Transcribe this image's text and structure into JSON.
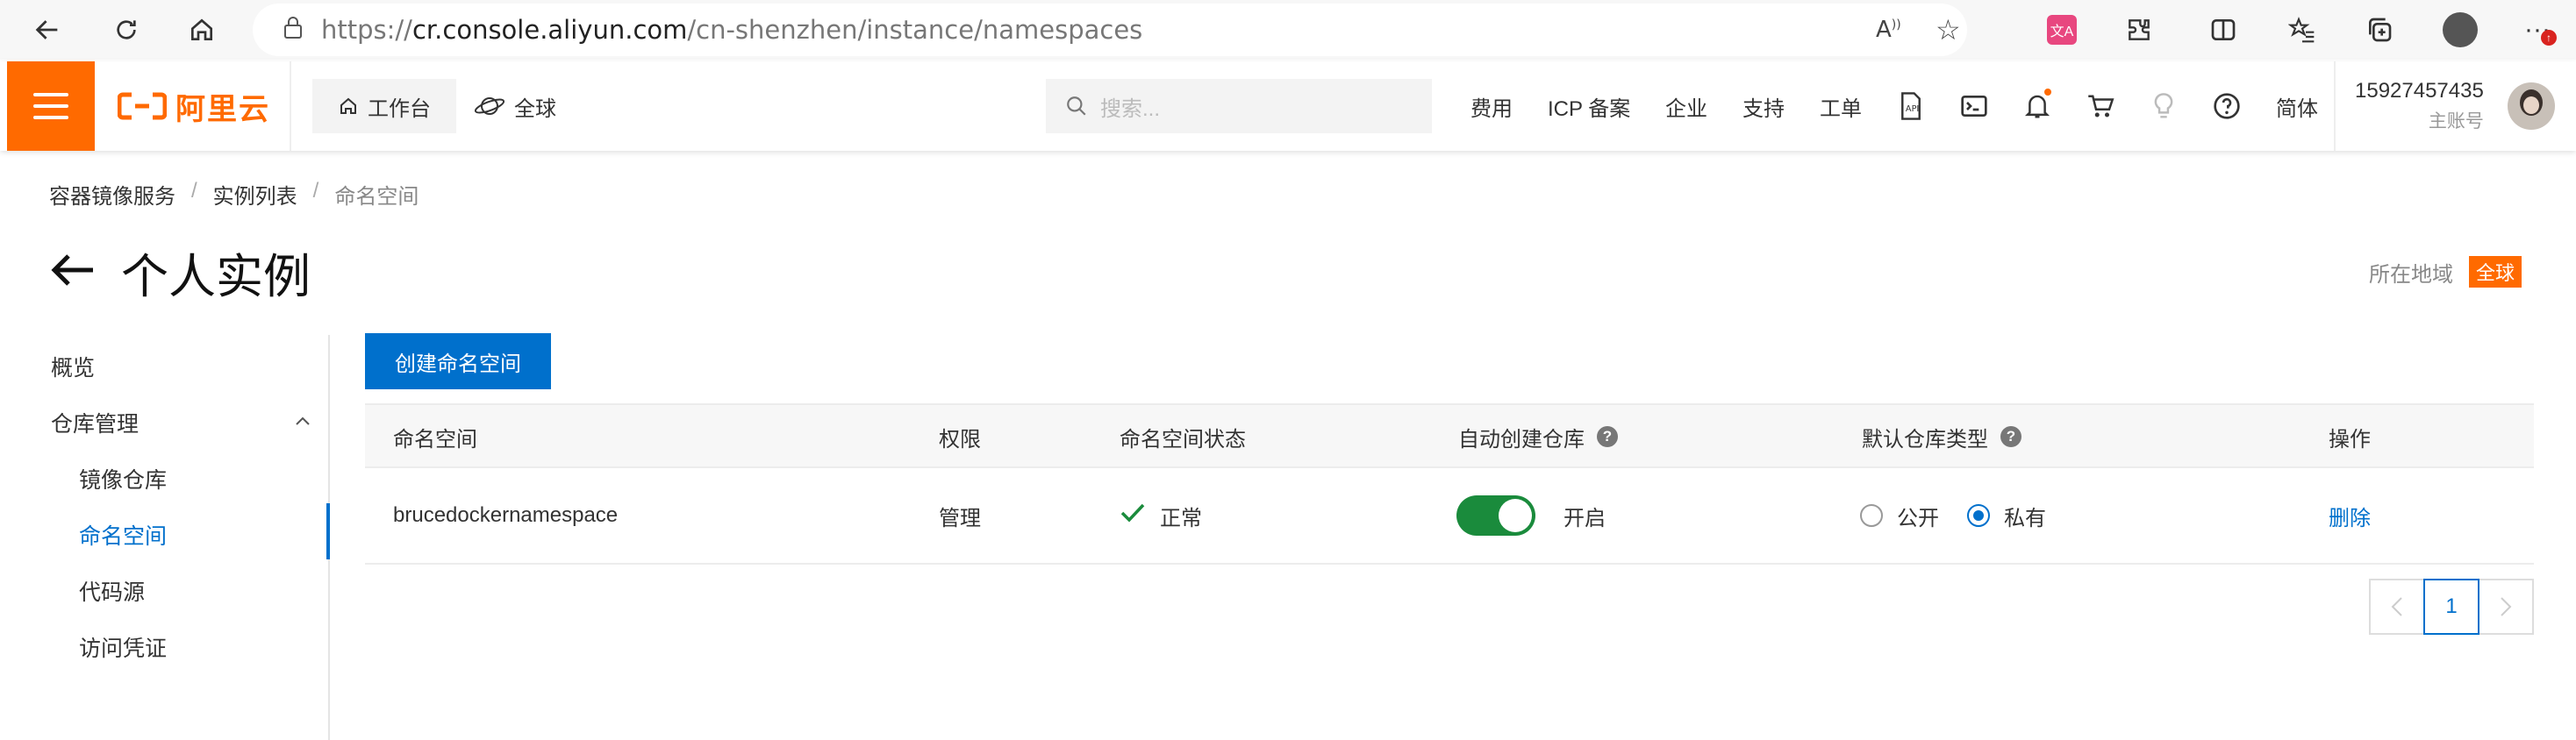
{
  "browser": {
    "url_prefix": "https://",
    "url_host": "cr.console.aliyun.com",
    "url_path": "/cn-shenzhen/instance/namespaces"
  },
  "topnav": {
    "logo_text": "阿里云",
    "workbench_label": "工作台",
    "global_label": "全球",
    "search_placeholder": "搜索...",
    "links": [
      "费用",
      "ICP 备案",
      "企业",
      "支持",
      "工单"
    ],
    "language": "简体",
    "account_id": "15927457435",
    "account_role": "主账号"
  },
  "breadcrumb": [
    "容器镜像服务",
    "实例列表",
    "命名空间"
  ],
  "page_title": "个人实例",
  "region": {
    "label": "所在地域",
    "value": "全球"
  },
  "sidebar": {
    "overview": "概览",
    "repo_mgmt": "仓库管理",
    "items": [
      "镜像仓库",
      "命名空间",
      "代码源",
      "访问凭证"
    ],
    "active_index": 1
  },
  "create_button": "创建命名空间",
  "table": {
    "columns": [
      "命名空间",
      "权限",
      "命名空间状态",
      "自动创建仓库",
      "默认仓库类型",
      "操作"
    ],
    "rows": [
      {
        "namespace": "brucedockernamespace",
        "permission": "管理",
        "status": "正常",
        "auto_create": "开启",
        "auto_create_on": true,
        "repo_type_options": [
          "公开",
          "私有"
        ],
        "repo_type_selected": "私有",
        "action": "删除"
      }
    ]
  },
  "pagination": {
    "current_page": "1"
  },
  "colors": {
    "brand": "#ff6a00",
    "primary": "#0070cc",
    "switch_on": "#1a8b3c"
  }
}
